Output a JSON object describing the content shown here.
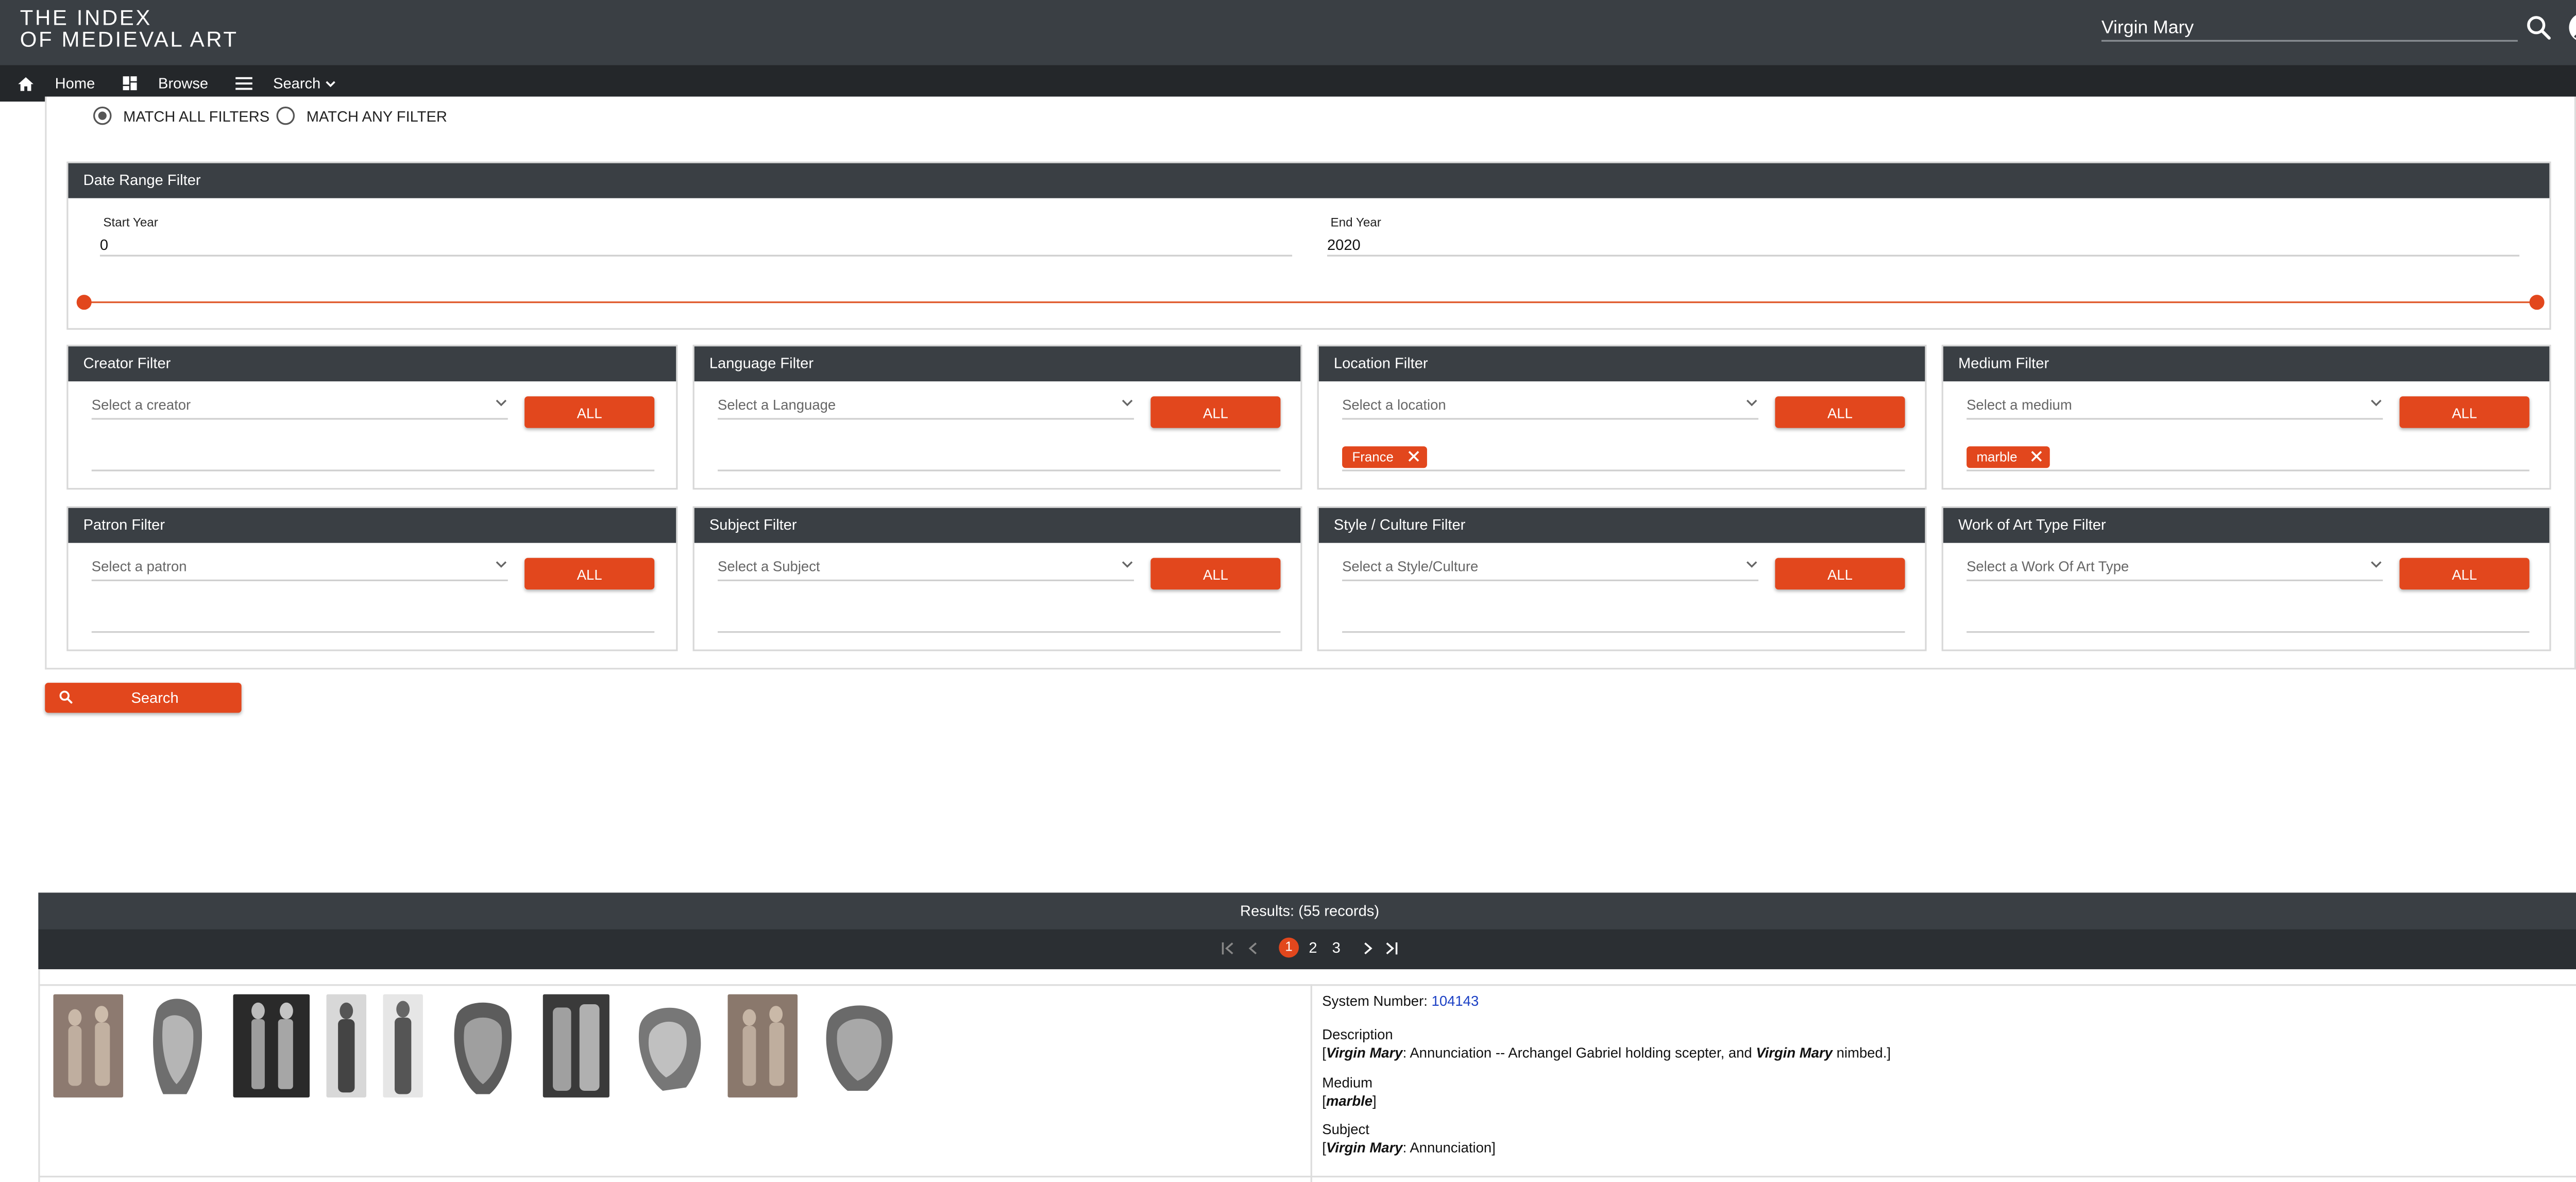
{
  "header": {
    "logo_line1": "THE INDEX",
    "logo_line2": "OF MEDIEVAL ART",
    "search_value": "Virgin Mary",
    "icons": [
      "search-icon",
      "account-circle-icon"
    ]
  },
  "nav": {
    "home": "Home",
    "browse": "Browse",
    "search": "Search"
  },
  "match": {
    "all": "MATCH ALL FILTERS",
    "any": "MATCH ANY FILTER",
    "selected": "all"
  },
  "date_filter": {
    "title": "Date Range Filter",
    "start_label": "Start Year",
    "start_value": "0",
    "end_label": "End Year",
    "end_value": "2020"
  },
  "filters": {
    "creator": {
      "title": "Creator Filter",
      "placeholder": "Select a creator",
      "button": "ALL"
    },
    "language": {
      "title": "Language Filter",
      "placeholder": "Select a Language",
      "button": "ALL"
    },
    "location": {
      "title": "Location Filter",
      "placeholder": "Select a location",
      "button": "ALL",
      "chip": "France"
    },
    "medium": {
      "title": "Medium Filter",
      "placeholder": "Select a medium",
      "button": "ALL",
      "chip": "marble"
    },
    "patron": {
      "title": "Patron Filter",
      "placeholder": "Select a patron",
      "button": "ALL"
    },
    "subject": {
      "title": "Subject Filter",
      "placeholder": "Select a Subject",
      "button": "ALL"
    },
    "style": {
      "title": "Style / Culture Filter",
      "placeholder": "Select a Style/Culture",
      "button": "ALL"
    },
    "worktype": {
      "title": "Work of Art Type Filter",
      "placeholder": "Select a Work Of Art Type",
      "button": "ALL"
    }
  },
  "search_button": "Search",
  "results": {
    "header": "Results: (55 records)",
    "pages": [
      "1",
      "2",
      "3"
    ],
    "current_page": "1",
    "record": {
      "system_label": "System Number:",
      "system_number": "104143",
      "description_label": "Description",
      "description_term1": "Virgin Mary",
      "description_text": ": Annunciation -- Archangel Gabriel holding scepter, and ",
      "description_term2": "Virgin Mary",
      "description_tail": " nimbed.",
      "medium_label": "Medium",
      "medium_value": "marble",
      "subject_label": "Subject",
      "subject_term": "Virgin Mary",
      "subject_tail": ": Annunciation"
    }
  },
  "colors": {
    "header_bg": "#3a3f44",
    "nav_bg": "#24272a",
    "accent": "#e2471d"
  }
}
